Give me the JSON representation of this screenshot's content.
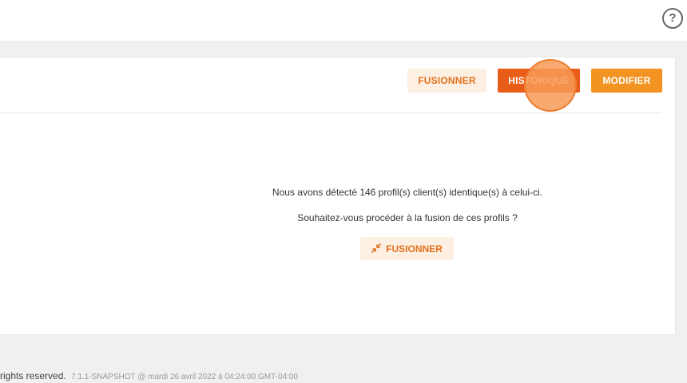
{
  "header": {
    "help_icon": "question-circle-icon",
    "help_glyph": "?"
  },
  "toolbar": {
    "merge_label": "FUSIONNER",
    "history_label": "HISTORIQUE",
    "edit_label": "MODIFIER"
  },
  "merge_panel": {
    "detected_text": "Nous avons détecté 146 profil(s) client(s) identique(s) à celui-ci.",
    "question_text": "Souhaitez-vous procéder à la fusion de ces profils ?",
    "button_label": "FUSIONNER",
    "button_icon": "merge-arrows-icon"
  },
  "footer": {
    "rights_text": "rights reserved.",
    "version_text": "7.1.1-SNAPSHOT @ mardi 26 avril 2022 à 04:24:00 GMT-04:00"
  },
  "colors": {
    "accent_light": "#fdf0e2",
    "accent_text": "#e2711d",
    "history_bg": "#e85d17",
    "edit_bg": "#f39322"
  }
}
